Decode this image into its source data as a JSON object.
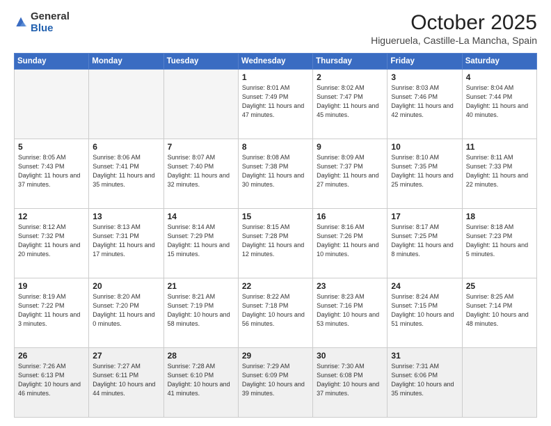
{
  "header": {
    "logo_general": "General",
    "logo_blue": "Blue",
    "month": "October 2025",
    "location": "Higueruela, Castille-La Mancha, Spain"
  },
  "days_of_week": [
    "Sunday",
    "Monday",
    "Tuesday",
    "Wednesday",
    "Thursday",
    "Friday",
    "Saturday"
  ],
  "weeks": [
    [
      {
        "num": "",
        "info": ""
      },
      {
        "num": "",
        "info": ""
      },
      {
        "num": "",
        "info": ""
      },
      {
        "num": "1",
        "info": "Sunrise: 8:01 AM\nSunset: 7:49 PM\nDaylight: 11 hours\nand 47 minutes."
      },
      {
        "num": "2",
        "info": "Sunrise: 8:02 AM\nSunset: 7:47 PM\nDaylight: 11 hours\nand 45 minutes."
      },
      {
        "num": "3",
        "info": "Sunrise: 8:03 AM\nSunset: 7:46 PM\nDaylight: 11 hours\nand 42 minutes."
      },
      {
        "num": "4",
        "info": "Sunrise: 8:04 AM\nSunset: 7:44 PM\nDaylight: 11 hours\nand 40 minutes."
      }
    ],
    [
      {
        "num": "5",
        "info": "Sunrise: 8:05 AM\nSunset: 7:43 PM\nDaylight: 11 hours\nand 37 minutes."
      },
      {
        "num": "6",
        "info": "Sunrise: 8:06 AM\nSunset: 7:41 PM\nDaylight: 11 hours\nand 35 minutes."
      },
      {
        "num": "7",
        "info": "Sunrise: 8:07 AM\nSunset: 7:40 PM\nDaylight: 11 hours\nand 32 minutes."
      },
      {
        "num": "8",
        "info": "Sunrise: 8:08 AM\nSunset: 7:38 PM\nDaylight: 11 hours\nand 30 minutes."
      },
      {
        "num": "9",
        "info": "Sunrise: 8:09 AM\nSunset: 7:37 PM\nDaylight: 11 hours\nand 27 minutes."
      },
      {
        "num": "10",
        "info": "Sunrise: 8:10 AM\nSunset: 7:35 PM\nDaylight: 11 hours\nand 25 minutes."
      },
      {
        "num": "11",
        "info": "Sunrise: 8:11 AM\nSunset: 7:33 PM\nDaylight: 11 hours\nand 22 minutes."
      }
    ],
    [
      {
        "num": "12",
        "info": "Sunrise: 8:12 AM\nSunset: 7:32 PM\nDaylight: 11 hours\nand 20 minutes."
      },
      {
        "num": "13",
        "info": "Sunrise: 8:13 AM\nSunset: 7:31 PM\nDaylight: 11 hours\nand 17 minutes."
      },
      {
        "num": "14",
        "info": "Sunrise: 8:14 AM\nSunset: 7:29 PM\nDaylight: 11 hours\nand 15 minutes."
      },
      {
        "num": "15",
        "info": "Sunrise: 8:15 AM\nSunset: 7:28 PM\nDaylight: 11 hours\nand 12 minutes."
      },
      {
        "num": "16",
        "info": "Sunrise: 8:16 AM\nSunset: 7:26 PM\nDaylight: 11 hours\nand 10 minutes."
      },
      {
        "num": "17",
        "info": "Sunrise: 8:17 AM\nSunset: 7:25 PM\nDaylight: 11 hours\nand 8 minutes."
      },
      {
        "num": "18",
        "info": "Sunrise: 8:18 AM\nSunset: 7:23 PM\nDaylight: 11 hours\nand 5 minutes."
      }
    ],
    [
      {
        "num": "19",
        "info": "Sunrise: 8:19 AM\nSunset: 7:22 PM\nDaylight: 11 hours\nand 3 minutes."
      },
      {
        "num": "20",
        "info": "Sunrise: 8:20 AM\nSunset: 7:20 PM\nDaylight: 11 hours\nand 0 minutes."
      },
      {
        "num": "21",
        "info": "Sunrise: 8:21 AM\nSunset: 7:19 PM\nDaylight: 10 hours\nand 58 minutes."
      },
      {
        "num": "22",
        "info": "Sunrise: 8:22 AM\nSunset: 7:18 PM\nDaylight: 10 hours\nand 56 minutes."
      },
      {
        "num": "23",
        "info": "Sunrise: 8:23 AM\nSunset: 7:16 PM\nDaylight: 10 hours\nand 53 minutes."
      },
      {
        "num": "24",
        "info": "Sunrise: 8:24 AM\nSunset: 7:15 PM\nDaylight: 10 hours\nand 51 minutes."
      },
      {
        "num": "25",
        "info": "Sunrise: 8:25 AM\nSunset: 7:14 PM\nDaylight: 10 hours\nand 48 minutes."
      }
    ],
    [
      {
        "num": "26",
        "info": "Sunrise: 7:26 AM\nSunset: 6:13 PM\nDaylight: 10 hours\nand 46 minutes."
      },
      {
        "num": "27",
        "info": "Sunrise: 7:27 AM\nSunset: 6:11 PM\nDaylight: 10 hours\nand 44 minutes."
      },
      {
        "num": "28",
        "info": "Sunrise: 7:28 AM\nSunset: 6:10 PM\nDaylight: 10 hours\nand 41 minutes."
      },
      {
        "num": "29",
        "info": "Sunrise: 7:29 AM\nSunset: 6:09 PM\nDaylight: 10 hours\nand 39 minutes."
      },
      {
        "num": "30",
        "info": "Sunrise: 7:30 AM\nSunset: 6:08 PM\nDaylight: 10 hours\nand 37 minutes."
      },
      {
        "num": "31",
        "info": "Sunrise: 7:31 AM\nSunset: 6:06 PM\nDaylight: 10 hours\nand 35 minutes."
      },
      {
        "num": "",
        "info": ""
      }
    ]
  ]
}
